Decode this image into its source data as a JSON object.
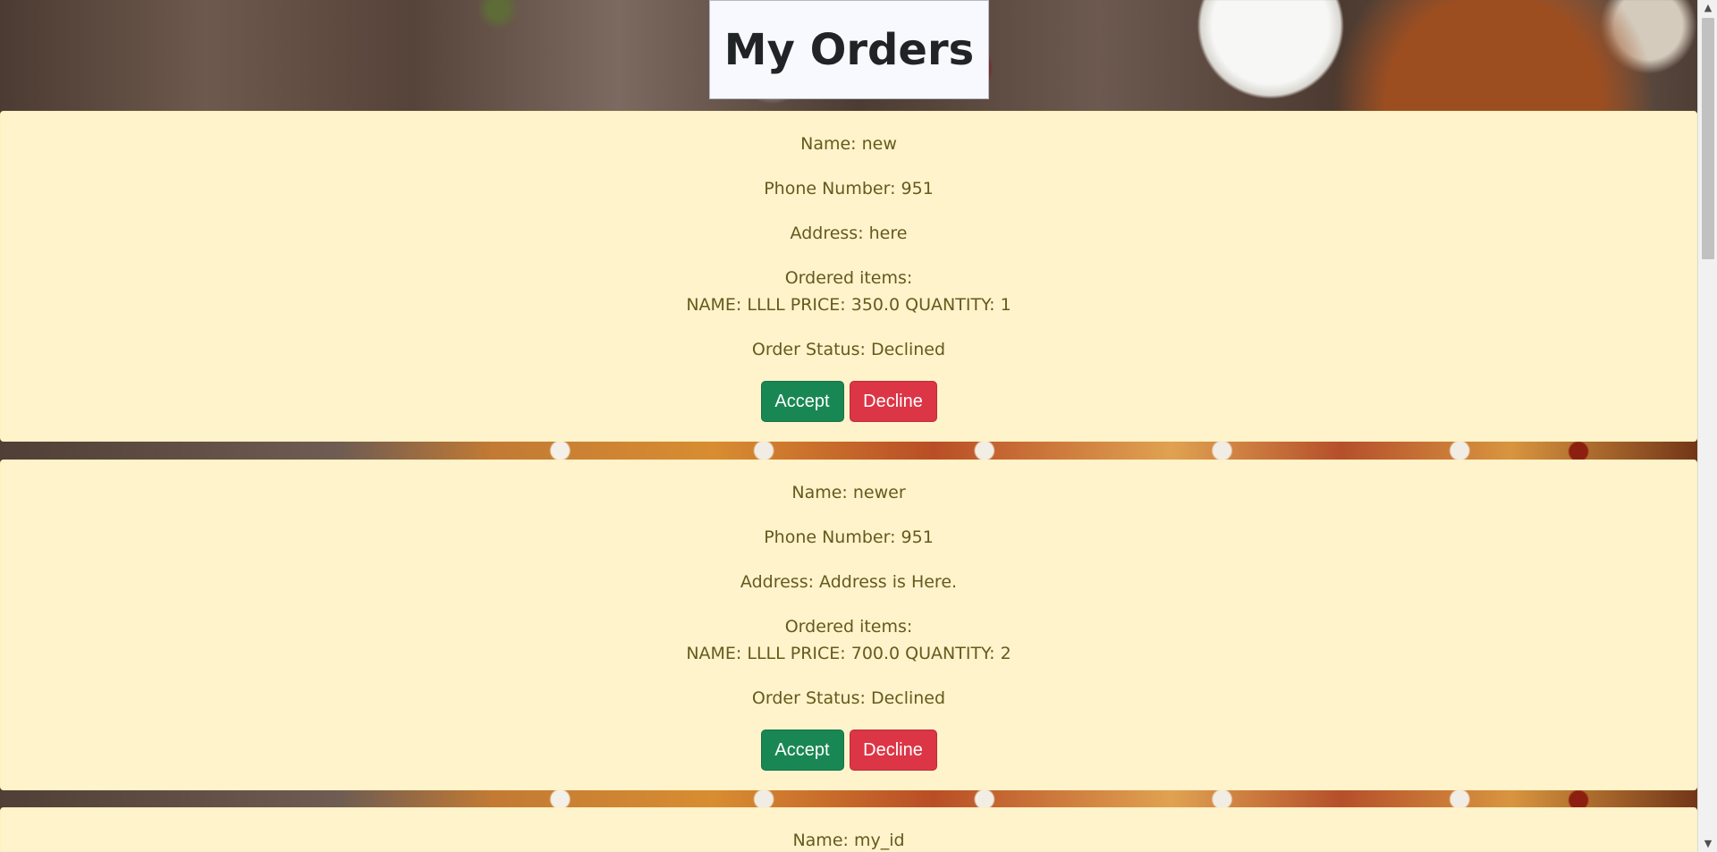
{
  "page": {
    "title": "My Orders"
  },
  "orders": [
    {
      "name": "Name: new",
      "phone": "Phone Number: 951",
      "address": "Address: here",
      "ordered_items_label": "Ordered items:",
      "item": "NAME: LLLL PRICE: 350.0 QUANTITY: 1",
      "status": "Order Status: Declined",
      "accept_label": "Accept",
      "decline_label": "Decline"
    },
    {
      "name": "Name: newer",
      "phone": "Phone Number: 951",
      "address": "Address: Address is Here.",
      "ordered_items_label": "Ordered items:",
      "item": "NAME: LLLL PRICE: 700.0 QUANTITY: 2",
      "status": "Order Status: Declined",
      "accept_label": "Accept",
      "decline_label": "Decline"
    },
    {
      "name": "Name: my_id"
    }
  ],
  "scrollbar": {
    "up_icon": "▲",
    "down_icon": "▼"
  },
  "colors": {
    "card_background": "#fff3cc",
    "text": "#655a1c",
    "accept": "#198754",
    "decline": "#dc3545",
    "title_background": "#f8f9ff"
  }
}
